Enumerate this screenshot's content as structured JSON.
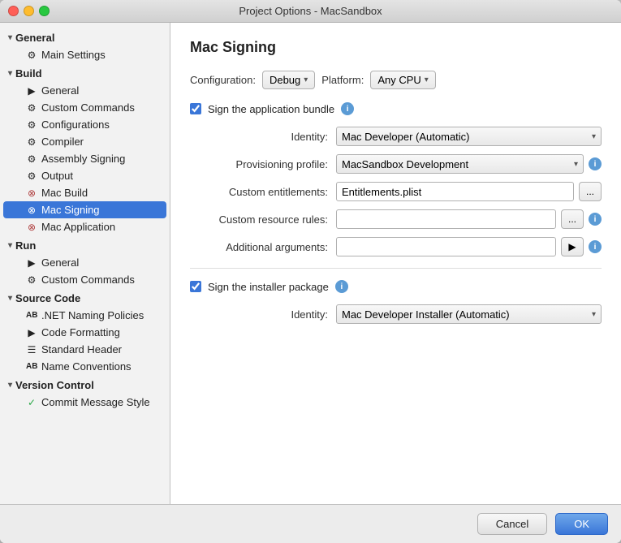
{
  "window": {
    "title": "Project Options - MacSandbox"
  },
  "traffic_lights": {
    "close_label": "close",
    "min_label": "minimize",
    "max_label": "maximize"
  },
  "sidebar": {
    "groups": [
      {
        "label": "General",
        "items": [
          {
            "label": "Main Settings",
            "icon": "⚙",
            "active": false
          }
        ]
      },
      {
        "label": "Build",
        "items": [
          {
            "label": "General",
            "icon": "▶",
            "active": false
          },
          {
            "label": "Custom Commands",
            "icon": "⚙",
            "active": false
          },
          {
            "label": "Configurations",
            "icon": "⚙",
            "active": false
          },
          {
            "label": "Compiler",
            "icon": "⚙",
            "active": false
          },
          {
            "label": "Assembly Signing",
            "icon": "⚙",
            "active": false
          },
          {
            "label": "Output",
            "icon": "⚙",
            "active": false
          },
          {
            "label": "Mac Build",
            "icon": "⊗",
            "active": false
          },
          {
            "label": "Mac Signing",
            "icon": "⊗",
            "active": true
          },
          {
            "label": "Mac Application",
            "icon": "⊗",
            "active": false
          }
        ]
      },
      {
        "label": "Run",
        "items": [
          {
            "label": "General",
            "icon": "▶",
            "active": false
          },
          {
            "label": "Custom Commands",
            "icon": "⚙",
            "active": false
          }
        ]
      },
      {
        "label": "Source Code",
        "items": [
          {
            "label": ".NET Naming Policies",
            "icon": "AB",
            "active": false
          },
          {
            "label": "Code Formatting",
            "icon": "▶",
            "active": false
          },
          {
            "label": "Standard Header",
            "icon": "☰",
            "active": false
          },
          {
            "label": "Name Conventions",
            "icon": "AB",
            "active": false
          }
        ]
      },
      {
        "label": "Version Control",
        "items": [
          {
            "label": "Commit Message Style",
            "icon": "✓",
            "active": false
          }
        ]
      }
    ]
  },
  "main": {
    "title": "Mac Signing",
    "config_label": "Configuration:",
    "config_value": "Debug",
    "platform_label": "Platform:",
    "platform_value": "Any CPU",
    "sign_bundle_label": "Sign the application bundle",
    "identity_label": "Identity:",
    "identity_value": "Mac Developer (Automatic)",
    "provisioning_label": "Provisioning profile:",
    "provisioning_value": "MacSandbox Development",
    "entitlements_label": "Custom entitlements:",
    "entitlements_value": "Entitlements.plist",
    "resource_rules_label": "Custom resource rules:",
    "resource_rules_value": "",
    "additional_args_label": "Additional arguments:",
    "additional_args_value": "",
    "sign_installer_label": "Sign the installer package",
    "installer_identity_label": "Identity:",
    "installer_identity_value": "Mac Developer Installer (Automatic)",
    "browse_btn": "...",
    "run_btn": "▶",
    "cancel_btn": "Cancel",
    "ok_btn": "OK"
  }
}
